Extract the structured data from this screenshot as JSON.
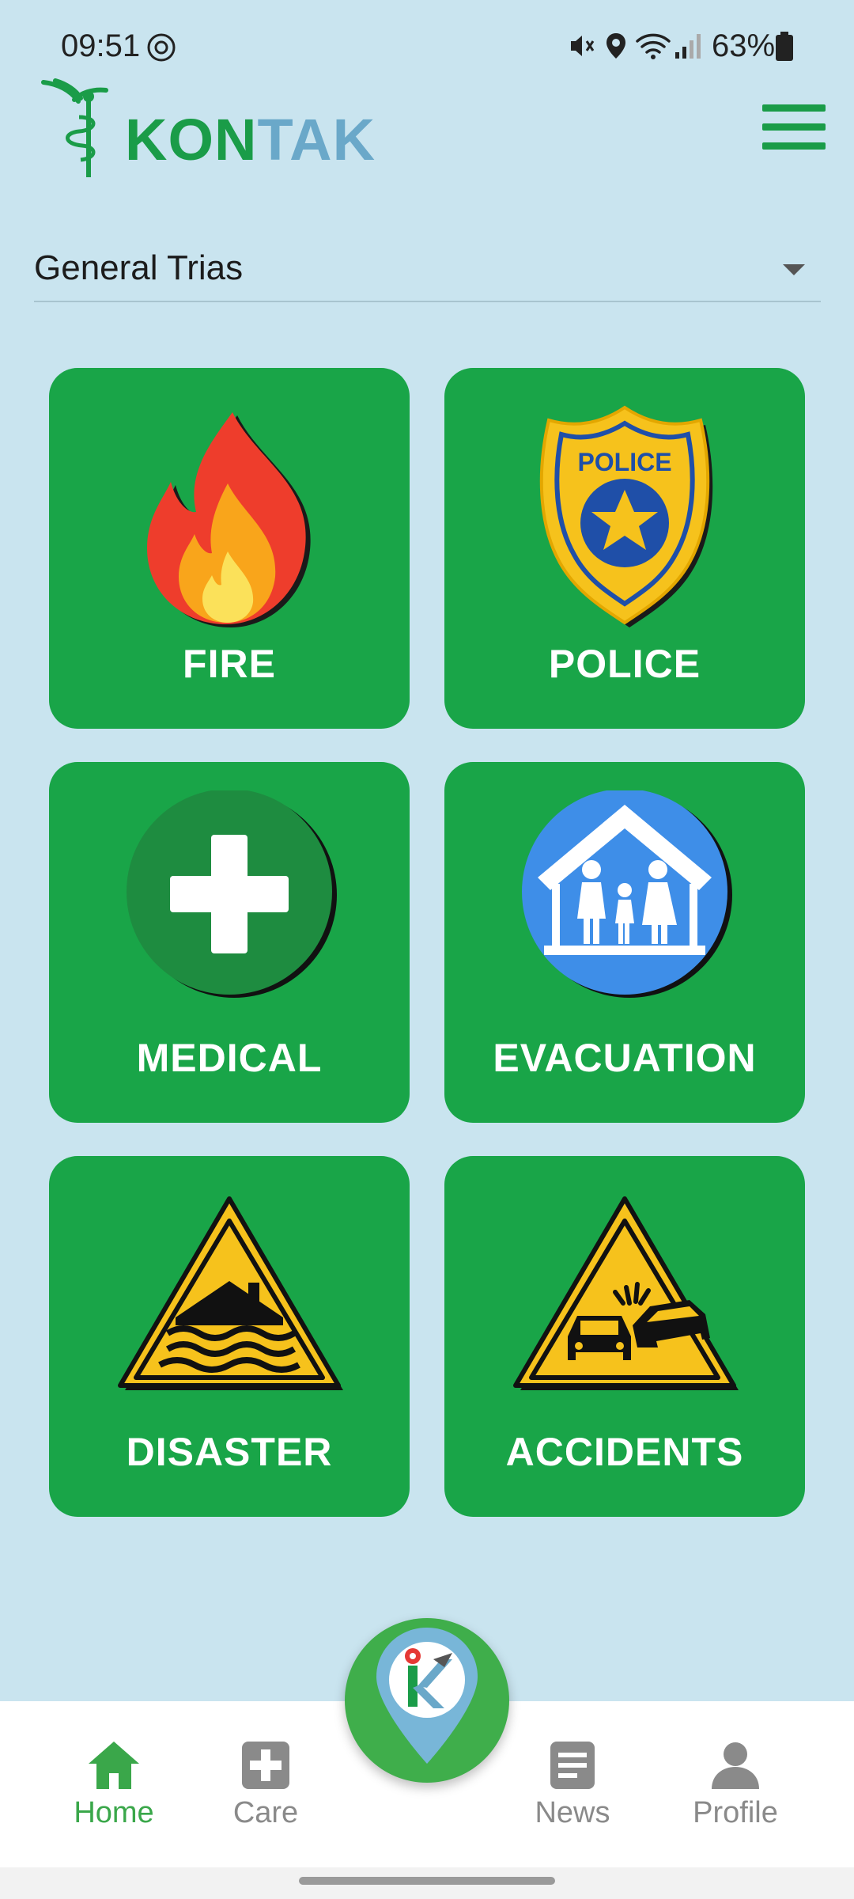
{
  "status_bar": {
    "time": "09:51",
    "battery": "63%"
  },
  "header": {
    "logo": {
      "text_k": "K",
      "text_on": "ON",
      "text_tak": "TAK"
    },
    "menu_icon": "hamburger-menu-icon"
  },
  "location": {
    "selected": "General Trias"
  },
  "categories": [
    {
      "label": "FIRE",
      "icon": "fire-icon"
    },
    {
      "label": "POLICE",
      "icon": "police-badge-icon",
      "badge_text": "POLICE"
    },
    {
      "label": "MEDICAL",
      "icon": "medical-cross-icon"
    },
    {
      "label": "EVACUATION",
      "icon": "evacuation-shelter-icon"
    },
    {
      "label": "DISASTER",
      "icon": "flood-warning-icon"
    },
    {
      "label": "ACCIDENTS",
      "icon": "car-accident-icon"
    }
  ],
  "bottom_nav": {
    "items": [
      {
        "label": "Home",
        "icon": "home-icon",
        "active": true
      },
      {
        "label": "Care",
        "icon": "care-plus-icon",
        "active": false
      },
      {
        "label": "News",
        "icon": "news-icon",
        "active": false
      },
      {
        "label": "Profile",
        "icon": "profile-icon",
        "active": false
      }
    ],
    "fab_icon": "kontak-map-pin-icon"
  },
  "colors": {
    "background": "#c9e4ef",
    "tile": "#19a548",
    "accent": "#1a9c48",
    "nav_active": "#3aa74a",
    "nav_inactive": "#8a8a8a"
  }
}
